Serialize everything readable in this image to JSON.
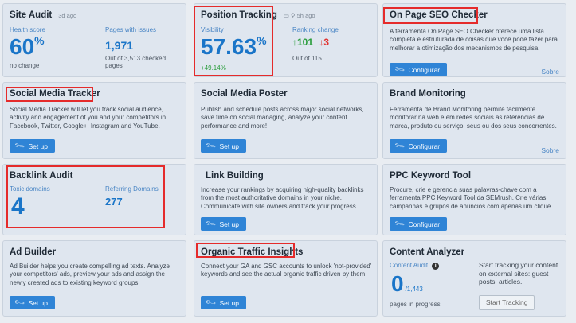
{
  "site_audit": {
    "title": "Site Audit",
    "updated": "3d ago",
    "health_label": "Health score",
    "health_value": "60",
    "health_unit": "%",
    "health_change": "no change",
    "issues_label": "Pages with issues",
    "issues_value": "1,971",
    "issues_note": "Out of 3,513 checked pages"
  },
  "position_tracking": {
    "title": "Position Tracking",
    "updated": "5h ago",
    "visibility_label": "Visibility",
    "visibility_value": "57.63",
    "visibility_unit": "%",
    "visibility_change": "+49.14%",
    "ranking_label": "Ranking change",
    "up_value": "101",
    "down_value": "3",
    "ranking_note": "Out of 115"
  },
  "on_page_seo": {
    "title": "On Page SEO Checker",
    "description": "A ferramenta On Page SEO Checker oferece uma lista completa e estruturada de coisas que você pode fazer para melhorar a otimização dos mecanismos de pesquisa.",
    "button": "Configurar",
    "more": "Sobre"
  },
  "social_tracker": {
    "title": "Social Media Tracker",
    "description": "Social Media Tracker will let you track social audience, activity and engagement of you and your competitors in Facebook, Twitter, Google+, Instagram and YouTube.",
    "button": "Set up"
  },
  "social_poster": {
    "title": "Social Media Poster",
    "description": "Publish and schedule posts across major social networks, save time on social managing, analyze your content performance and more!",
    "button": "Set up"
  },
  "brand_monitoring": {
    "title": "Brand Monitoring",
    "description": "Ferramenta de Brand Monitoring permite facilmente monitorar na web e em redes sociais as referências de marca, produto ou serviço, seus ou dos seus concorrentes.",
    "button": "Configurar",
    "more": "Sobre"
  },
  "backlink_audit": {
    "title": "Backlink Audit",
    "toxic_label": "Toxic domains",
    "toxic_value": "4",
    "referring_label": "Referring Domains",
    "referring_value": "277"
  },
  "link_building": {
    "title": "Link Building",
    "description": "Increase your rankings by acquiring high-quality backlinks from the most authoritative domains in your niche. Communicate with site owners and track your progress.",
    "button": "Set up"
  },
  "ppc_keyword": {
    "title": "PPC Keyword Tool",
    "description": "Procure, crie e gerencia suas palavras-chave com a ferramenta PPC Keyword Tool da SEMrush. Crie várias campanhas e grupos de anúncios com apenas um clique.",
    "button": "Configurar"
  },
  "ad_builder": {
    "title": "Ad Builder",
    "description": "Ad Builder helps you create compelling ad texts. Analyze your competitors' ads, preview your ads and assign the newly created ads to existing keyword groups.",
    "button": "Set up"
  },
  "organic_traffic": {
    "title": "Organic Traffic Insights",
    "description": "Connect your GA and GSC accounts to unlock 'not-provided' keywords and see the actual organic traffic driven by them",
    "button": "Set up"
  },
  "content_analyzer": {
    "title": "Content Analyzer",
    "audit_label": "Content Audit",
    "audit_value": "0",
    "audit_total": "/1,443",
    "audit_note": "pages in progress",
    "track_text": "Start tracking your content on external sites: guest posts, articles.",
    "track_button": "Start Tracking"
  },
  "colors": {
    "accent": "#1a75c8",
    "button": "#2f84d6",
    "highlight": "#e52b2b",
    "up": "#2a9d3c",
    "down": "#e0322f"
  }
}
